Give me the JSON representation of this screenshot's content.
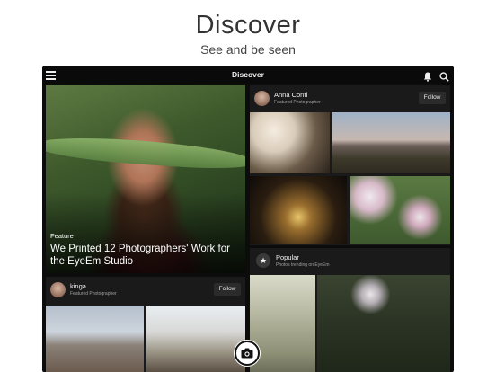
{
  "promo": {
    "title": "Discover",
    "subtitle": "See and be seen"
  },
  "topbar": {
    "title": "Discover",
    "menu_icon": "hamburger-menu-icon",
    "notifications_icon": "bell-icon",
    "search_icon": "search-icon"
  },
  "feature": {
    "kicker": "Feature",
    "headline": "We Printed 12 Photographers' Work for the EyeEm Studio"
  },
  "photographer_left": {
    "name": "kinga",
    "role": "Featured Photographer",
    "follow_label": "Follow"
  },
  "photographer_right": {
    "name": "Anna Conti",
    "role": "Featured Photographer",
    "follow_label": "Follow"
  },
  "popular": {
    "title": "Popular",
    "subtitle": "Photos trending on EyeEm",
    "icon": "star-icon"
  },
  "camera": {
    "icon": "camera-icon"
  },
  "colors": {
    "background": "#0c0c0c",
    "card": "#1a1a1a",
    "text": "#f2f2f2"
  }
}
